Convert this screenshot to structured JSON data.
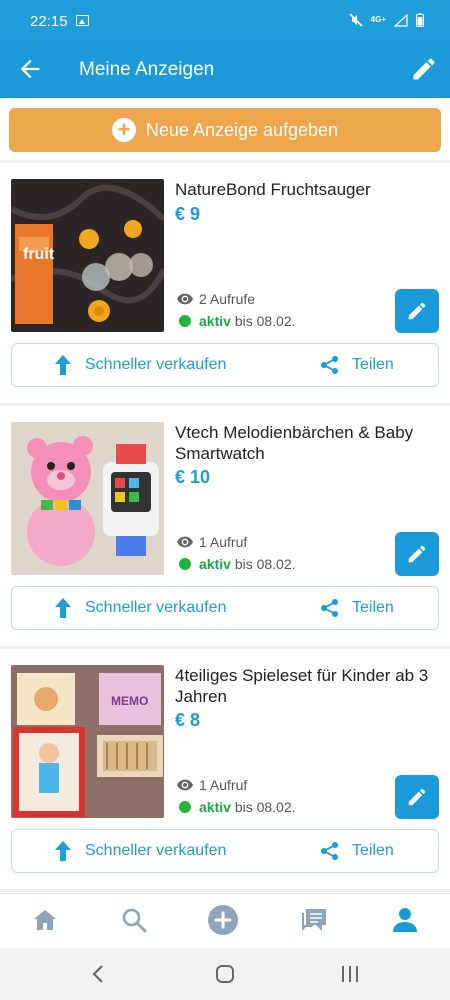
{
  "status_bar": {
    "time": "22:15",
    "network": "4G+"
  },
  "app_bar": {
    "title": "Meine Anzeigen"
  },
  "new_ad": {
    "label": "Neue Anzeige aufgeben"
  },
  "listings": [
    {
      "title": "NatureBond Fruchtsauger",
      "price": "€ 9",
      "views": "2 Aufrufe",
      "status": "aktiv",
      "until": "bis 08.02.",
      "sell_label": "Schneller verkaufen",
      "share_label": "Teilen"
    },
    {
      "title": "Vtech Melodienbärchen & Baby Smartwatch",
      "price": "€ 10",
      "views": "1 Aufruf",
      "status": "aktiv",
      "until": "bis 08.02.",
      "sell_label": "Schneller verkaufen",
      "share_label": "Teilen"
    },
    {
      "title": "4teiliges Spieleset für Kinder ab 3 Jahren",
      "price": "€ 8",
      "views": "1 Aufruf",
      "status": "aktiv",
      "until": "bis 08.02.",
      "sell_label": "Schneller verkaufen",
      "share_label": "Teilen"
    }
  ],
  "thumb_labels": {
    "fruit_box": "fruit",
    "memo_box": "MEMO"
  },
  "bottom_nav": [
    "home-icon",
    "search-icon",
    "add-icon",
    "messages-icon",
    "profile-icon"
  ],
  "colors": {
    "primary": "#1a9ad8",
    "accent": "#eea64c",
    "active": "#1fb43a"
  }
}
